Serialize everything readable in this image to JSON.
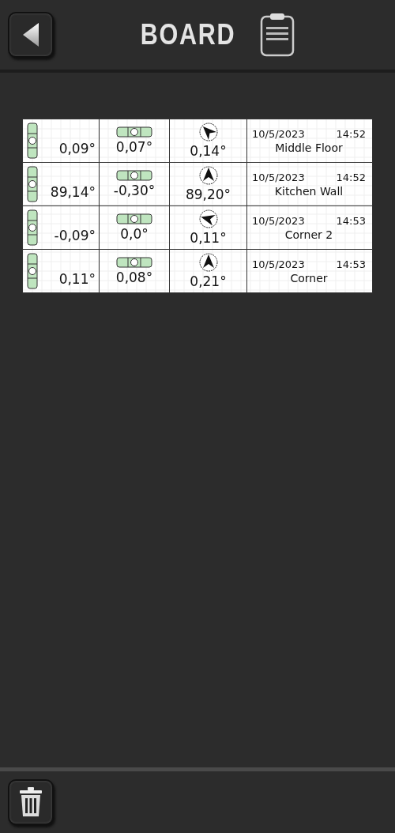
{
  "header": {
    "title": "BOARD"
  },
  "rows": [
    {
      "vertical": "0,09°",
      "horizontal": "0,07°",
      "compass": "0,14°",
      "kind": "up-left",
      "date": "10/5/2023",
      "time": "14:52",
      "name": "Middle Floor"
    },
    {
      "vertical": "89,14°",
      "horizontal": "-0,30°",
      "compass": "89,20°",
      "kind": "up",
      "date": "10/5/2023",
      "time": "14:52",
      "name": "Kitchen Wall"
    },
    {
      "vertical": "-0,09°",
      "horizontal": "0,0°",
      "compass": "0,11°",
      "kind": "left",
      "date": "10/5/2023",
      "time": "14:53",
      "name": "Corner 2"
    },
    {
      "vertical": "0,11°",
      "horizontal": "0,08°",
      "compass": "0,21°",
      "kind": "up",
      "date": "10/5/2023",
      "time": "14:53",
      "name": "Corner"
    }
  ]
}
